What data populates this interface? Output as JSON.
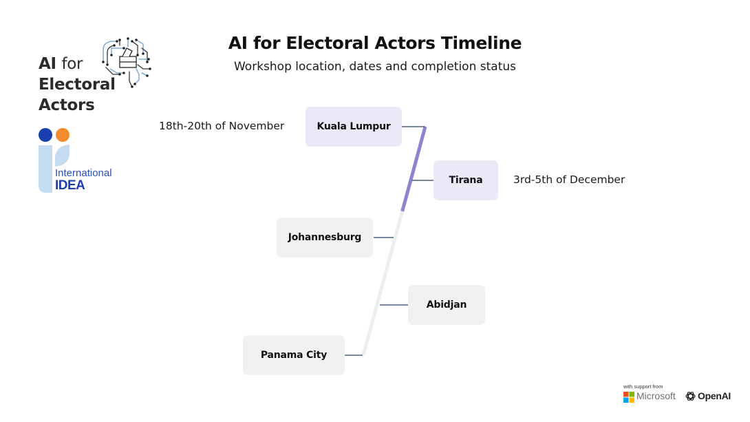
{
  "branding": {
    "program_title_bold_1": "AI",
    "program_title_light": "for",
    "program_title_line2": "Electoral",
    "program_title_line3": "Actors",
    "org_name_line1": "International",
    "org_name_line2": "IDEA",
    "colors": {
      "idea_blue": "#1c3fb0",
      "idea_orange": "#f58a2e",
      "idea_light": "#c5dbef"
    }
  },
  "header": {
    "title": "AI for Electoral Actors Timeline",
    "subtitle": "Workshop location, dates and completion status"
  },
  "timeline": {
    "colors": {
      "completed": "#8d84cf",
      "pending": "#eeeeee",
      "connector": "#4a6283",
      "completed_box": "#ebe8f8",
      "pending_box": "#f1f1f1"
    },
    "progress_fraction": 0.37,
    "workshops": [
      {
        "city": "Kuala Lumpur",
        "dates": "18th-20th of November",
        "status": "completed",
        "side": "left"
      },
      {
        "city": "Tirana",
        "dates": "3rd-5th of December",
        "status": "completed",
        "side": "right"
      },
      {
        "city": "Johannesburg",
        "dates": "",
        "status": "pending",
        "side": "left"
      },
      {
        "city": "Abidjan",
        "dates": "",
        "status": "pending",
        "side": "right"
      },
      {
        "city": "Panama City",
        "dates": "",
        "status": "pending",
        "side": "left"
      }
    ]
  },
  "footer": {
    "support_label": "with support from",
    "sponsors": [
      "Microsoft",
      "OpenAI"
    ]
  }
}
